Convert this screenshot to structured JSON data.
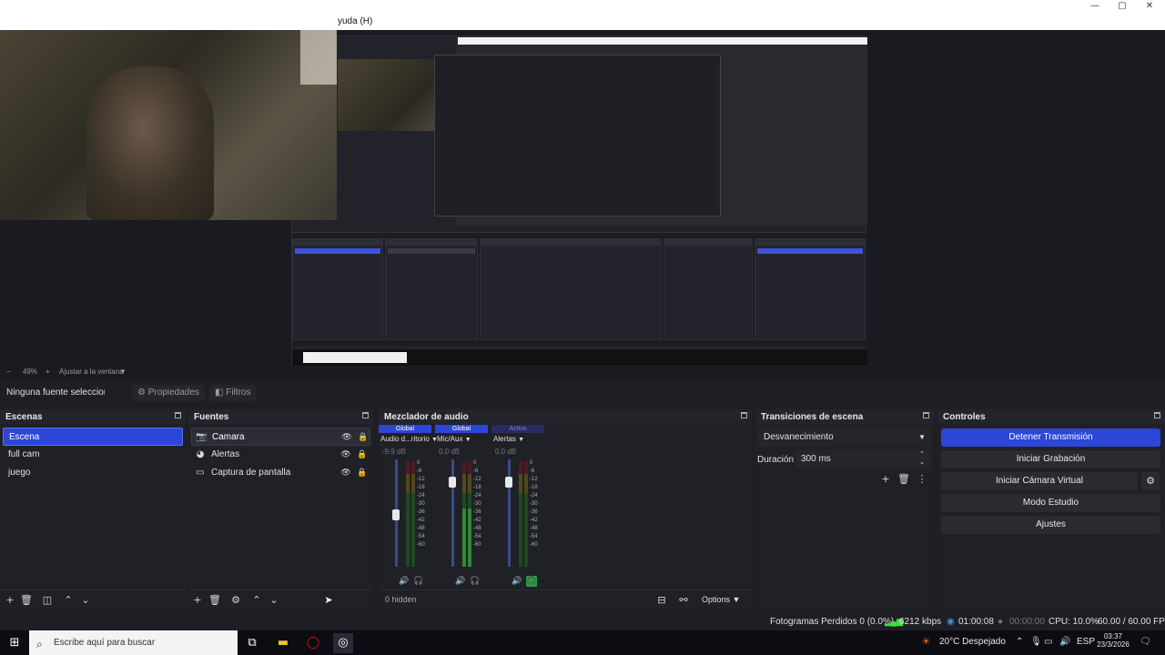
{
  "window": {
    "menu_visible": "yuda (H)",
    "controls": {
      "minimize": "—",
      "maximize": "▢",
      "close": "✕"
    }
  },
  "preview": {
    "zoom_minus": "−",
    "zoom_value": "49%",
    "zoom_plus": "+",
    "fit_label": "Ajustar a la ventana"
  },
  "source_bar": {
    "no_source": "Ninguna fuente seleccionada",
    "properties": "Propiedades",
    "filters": "Filtros"
  },
  "scenes": {
    "title": "Escenas",
    "items": [
      "Escena",
      "full cam",
      "juego"
    ],
    "selected": 0
  },
  "sources": {
    "title": "Fuentes",
    "items": [
      {
        "label": "Camara",
        "icon": "camera-icon"
      },
      {
        "label": "Alertas",
        "icon": "browser-icon"
      },
      {
        "label": "Captura de pantalla",
        "icon": "monitor-icon"
      }
    ]
  },
  "mixer": {
    "title": "Mezclador de audio",
    "channels": [
      {
        "badge": "Global",
        "name": "Audio d...ritorio",
        "db": "-9.9 dB",
        "level": 0.0,
        "badge_style": "global"
      },
      {
        "badge": "Global",
        "name": "Mic/Aux",
        "db": "0.0 dB",
        "level": 0.55,
        "badge_style": "global"
      },
      {
        "badge": "Activo",
        "name": "Alertas",
        "db": "0.0 dB",
        "level": 0.0,
        "badge_style": "active"
      }
    ],
    "scale": [
      "0",
      "-6",
      "-12",
      "-18",
      "-24",
      "-30",
      "-36",
      "-42",
      "-48",
      "-54",
      "-60"
    ],
    "hidden_label": "0 hidden",
    "options_label": "Options"
  },
  "transitions": {
    "title": "Transiciones de escena",
    "selected": "Desvanecimiento",
    "duration_label": "Duración",
    "duration_value": "300 ms"
  },
  "controls": {
    "title": "Controles",
    "buttons": [
      "Detener Transmisión",
      "Iniciar Grabación",
      "Iniciar Cámara Virtual",
      "Modo Estudio",
      "Ajustes"
    ]
  },
  "status": {
    "dropped": "Fotogramas Perdidos 0 (0.0%)",
    "bitrate": "6212 kbps",
    "stream_time": "01:00:08",
    "rec_time": "00:00:00",
    "cpu": "CPU: 10.0%",
    "fps": "60.00 / 60.00 FPS"
  },
  "taskbar": {
    "search_placeholder": "Escribe aquí para buscar",
    "weather": "20°C  Despejado",
    "lang": "ESP",
    "time": "03:37",
    "date": "23/3/2026"
  },
  "colors": {
    "accent": "#2c46d6",
    "meter_green": "#3ee03e",
    "monitor_on": "#1aa83a"
  }
}
